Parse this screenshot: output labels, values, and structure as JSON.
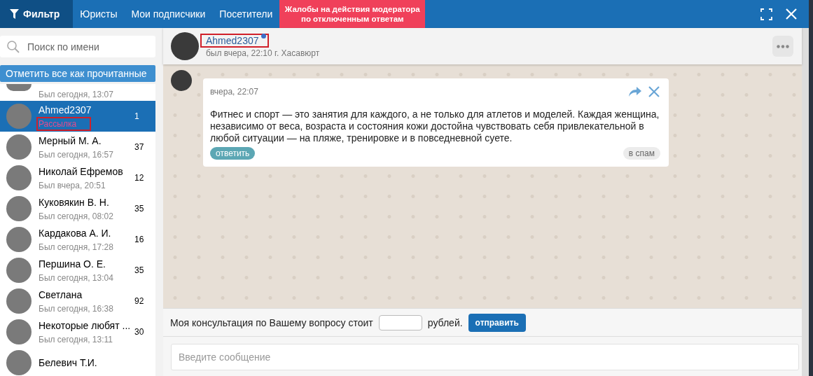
{
  "tabs": [
    {
      "label": "Фильтр",
      "kind": "filter",
      "selected": true
    },
    {
      "label": "Юристы",
      "kind": "plain",
      "selected": false
    },
    {
      "label": "Мои подписчики",
      "kind": "plain",
      "selected": false
    },
    {
      "label": "Посетители",
      "kind": "plain",
      "selected": false
    },
    {
      "label": "Жалобы на действия модератора по отключенным ответам",
      "kind": "alert",
      "selected": false
    }
  ],
  "sidebar": {
    "search": {
      "placeholder": "Поиск по имени"
    },
    "mark_all_button": "Отметить все как прочитанные",
    "contacts": [
      {
        "status": "Был сегодня, 13:07",
        "selected": false
      },
      {
        "name": "Ahmed2307",
        "status": "Рассылка",
        "count": "1",
        "selected": true,
        "highlighted": true
      },
      {
        "name": "Мерный М. А.",
        "status": "Был сегодня, 16:57",
        "count": "37",
        "selected": false
      },
      {
        "name": "Николай Ефремов",
        "status": "Был вчера, 20:51",
        "count": "12",
        "selected": false
      },
      {
        "name": "Куковякин В. Н.",
        "status": "Был сегодня, 08:02",
        "count": "35",
        "selected": false
      },
      {
        "name": "Кардакова А. И.",
        "status": "Был сегодня, 17:28",
        "count": "16",
        "selected": false
      },
      {
        "name": "Першина О. Е.",
        "status": "Был сегодня, 13:04",
        "count": "35",
        "selected": false
      },
      {
        "name": "Светлана",
        "status": "Был сегодня, 16:38",
        "count": "92",
        "selected": false
      },
      {
        "name": "Некоторые любят ...",
        "status": "Был сегодня, 13:11",
        "count": "30",
        "selected": false
      },
      {
        "name": "Белевич Т.И.",
        "selected": false
      }
    ]
  },
  "chat": {
    "name": "Ahmed2307",
    "name_highlighted": true,
    "last_seen": "был вчера, 22:10 г. Хасавюрт",
    "messages": [
      {
        "time": "вчера, 22:07",
        "text": "Фитнес и спорт — это занятия для каждого, а не только для атлетов и моделей. Каждая женщина, независимо от веса, возраста и состояния кожи достойна чувствовать себя привлекательной в любой ситуации — на пляже, тренировке и в повседневной суете.",
        "reply_button": "ответить",
        "spam_button": "в спам"
      }
    ],
    "price_bar": {
      "label": "Моя консультация по Вашему вопросу стоит",
      "unit": "рублей.",
      "send_button": "отправить"
    },
    "message_input": {
      "placeholder": "Введите сообщение"
    }
  }
}
